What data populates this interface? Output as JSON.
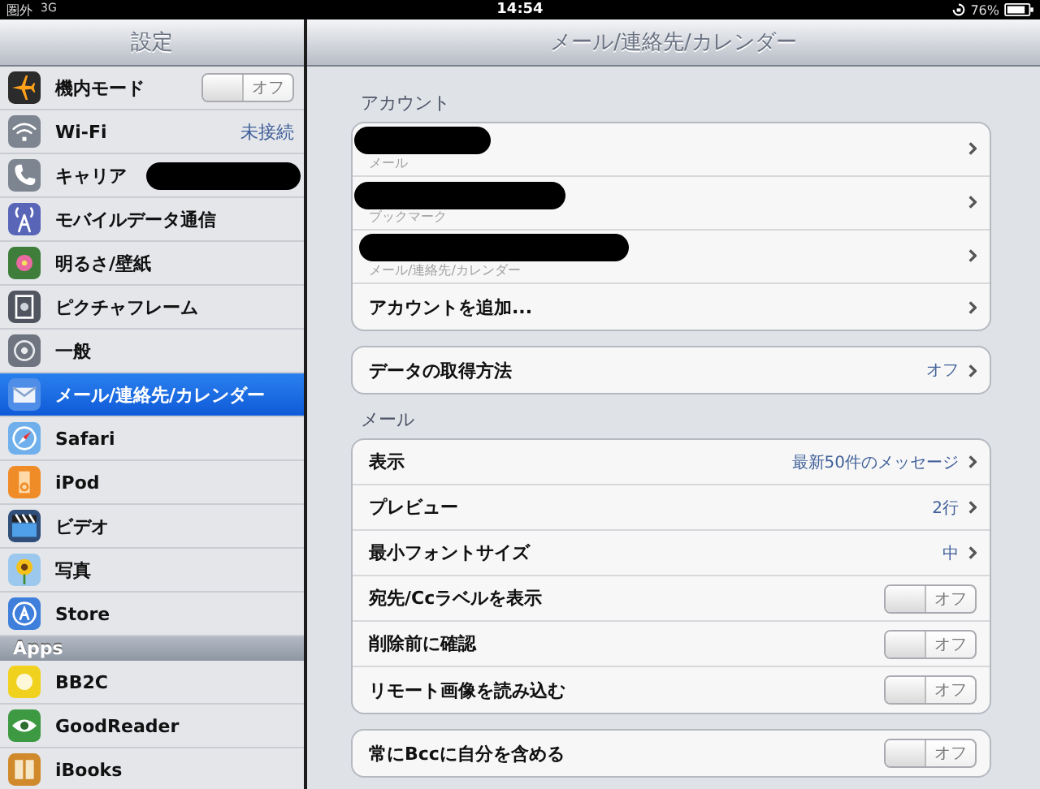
{
  "status_bar": {
    "carrier": "圏外",
    "network": "3G",
    "time": "14:54",
    "battery": "76%"
  },
  "sidebar": {
    "title": "設定",
    "sections": [
      {
        "items": [
          {
            "kind": "toggle",
            "label": "機内モード",
            "on": false,
            "state_label": "オフ",
            "selected": false
          },
          {
            "kind": "value",
            "label": "Wi-Fi",
            "value": "未接続",
            "selected": false
          },
          {
            "kind": "redacted",
            "label": "キャリア",
            "selected": false
          },
          {
            "kind": "plain",
            "label": "モバイルデータ通信",
            "selected": false
          },
          {
            "kind": "plain",
            "label": "明るさ/壁紙",
            "selected": false
          },
          {
            "kind": "plain",
            "label": "ピクチャフレーム",
            "selected": false
          },
          {
            "kind": "plain",
            "label": "一般",
            "selected": false
          },
          {
            "kind": "plain",
            "label": "メール/連絡先/カレンダー",
            "selected": true
          },
          {
            "kind": "plain",
            "label": "Safari",
            "selected": false
          },
          {
            "kind": "plain",
            "label": "iPod",
            "selected": false
          },
          {
            "kind": "plain",
            "label": "ビデオ",
            "selected": false
          },
          {
            "kind": "plain",
            "label": "写真",
            "selected": false
          },
          {
            "kind": "plain",
            "label": "Store",
            "selected": false
          }
        ]
      },
      {
        "header": "Apps",
        "items": [
          {
            "kind": "plain",
            "label": "BB2C",
            "selected": false
          },
          {
            "kind": "plain",
            "label": "GoodReader",
            "selected": false
          },
          {
            "kind": "plain",
            "label": "iBooks",
            "selected": false
          }
        ]
      }
    ]
  },
  "detail": {
    "title": "メール/連絡先/カレンダー",
    "groups": [
      {
        "header": "アカウント",
        "rows": [
          {
            "kind": "account",
            "subtitle": "メール"
          },
          {
            "kind": "account",
            "subtitle": "ブックマーク"
          },
          {
            "kind": "account",
            "subtitle": "メール/連絡先/カレンダー"
          },
          {
            "kind": "link",
            "label": "アカウントを追加..."
          }
        ]
      },
      {
        "rows": [
          {
            "kind": "link",
            "label": "データの取得方法",
            "value": "オフ"
          }
        ]
      },
      {
        "header": "メール",
        "rows": [
          {
            "kind": "link",
            "label": "表示",
            "value": "最新50件のメッセージ"
          },
          {
            "kind": "link",
            "label": "プレビュー",
            "value": "2行"
          },
          {
            "kind": "link",
            "label": "最小フォントサイズ",
            "value": "中"
          },
          {
            "kind": "toggle",
            "label": "宛先/Ccラベルを表示",
            "on": false,
            "state_label": "オフ"
          },
          {
            "kind": "toggle",
            "label": "削除前に確認",
            "on": false,
            "state_label": "オフ"
          },
          {
            "kind": "toggle",
            "label": "リモート画像を読み込む",
            "on": false,
            "state_label": "オフ"
          }
        ]
      },
      {
        "rows": [
          {
            "kind": "toggle",
            "label": "常にBccに自分を含める",
            "on": false,
            "state_label": "オフ"
          }
        ]
      }
    ]
  }
}
